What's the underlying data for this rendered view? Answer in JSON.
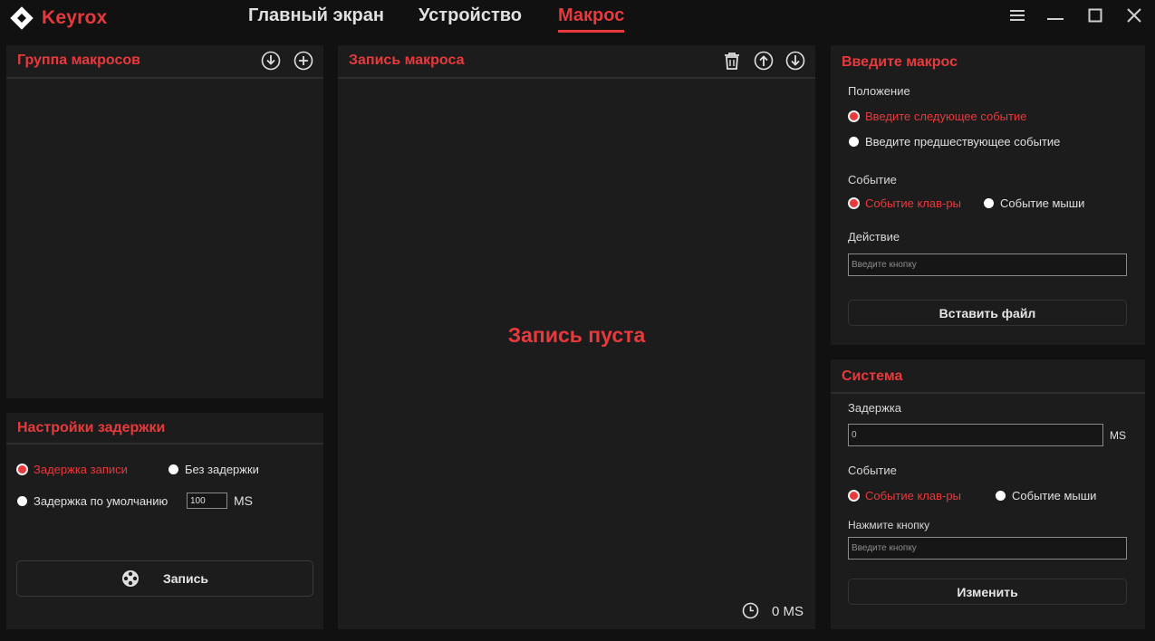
{
  "app": {
    "name": "Keyrox",
    "accent": "#e8393c"
  },
  "nav": {
    "tabs": [
      {
        "label": "Главный экран",
        "active": false
      },
      {
        "label": "Устройство",
        "active": false
      },
      {
        "label": "Макрос",
        "active": true
      }
    ]
  },
  "window_controls": [
    "menu-icon",
    "minimize-icon",
    "maximize-icon",
    "close-icon"
  ],
  "macro_group": {
    "title": "Группа макросов",
    "icons": [
      "download-icon",
      "add-icon"
    ]
  },
  "delay_settings": {
    "title": "Настройки задержки",
    "options": [
      {
        "label": "Задержка записи",
        "selected": true
      },
      {
        "label": "Без задержки",
        "selected": false
      },
      {
        "label": "Задержка по умолчанию",
        "selected": false
      }
    ],
    "default_value": "100",
    "unit": "MS",
    "record_button": "Запись"
  },
  "macro_record": {
    "title": "Запись макроса",
    "icons": [
      "trash-icon",
      "move-up-icon",
      "move-down-icon"
    ],
    "empty_text": "Запись пуста",
    "total_time": "0 MS"
  },
  "enter_macro": {
    "title": "Введите макрос",
    "position_label": "Положение",
    "position_options": [
      {
        "label": "Введите следующее событие",
        "selected": true
      },
      {
        "label": "Введите предшествующее событие",
        "selected": false
      }
    ],
    "event_label": "Событие",
    "event_options": [
      {
        "label": "Событие клав-ры",
        "selected": true
      },
      {
        "label": "Событие мыши",
        "selected": false
      }
    ],
    "action_label": "Действие",
    "action_placeholder": "Введите кнопку",
    "insert_file_button": "Вставить файл"
  },
  "system": {
    "title": "Система",
    "delay_label": "Задержка",
    "delay_value": "0",
    "delay_unit": "MS",
    "event_label": "Событие",
    "event_options": [
      {
        "label": "Событие клав-ры",
        "selected": true
      },
      {
        "label": "Событие мыши",
        "selected": false
      }
    ],
    "press_key_label": "Нажмите кнопку",
    "press_key_placeholder": "Введите кнопку",
    "change_button": "Изменить"
  }
}
